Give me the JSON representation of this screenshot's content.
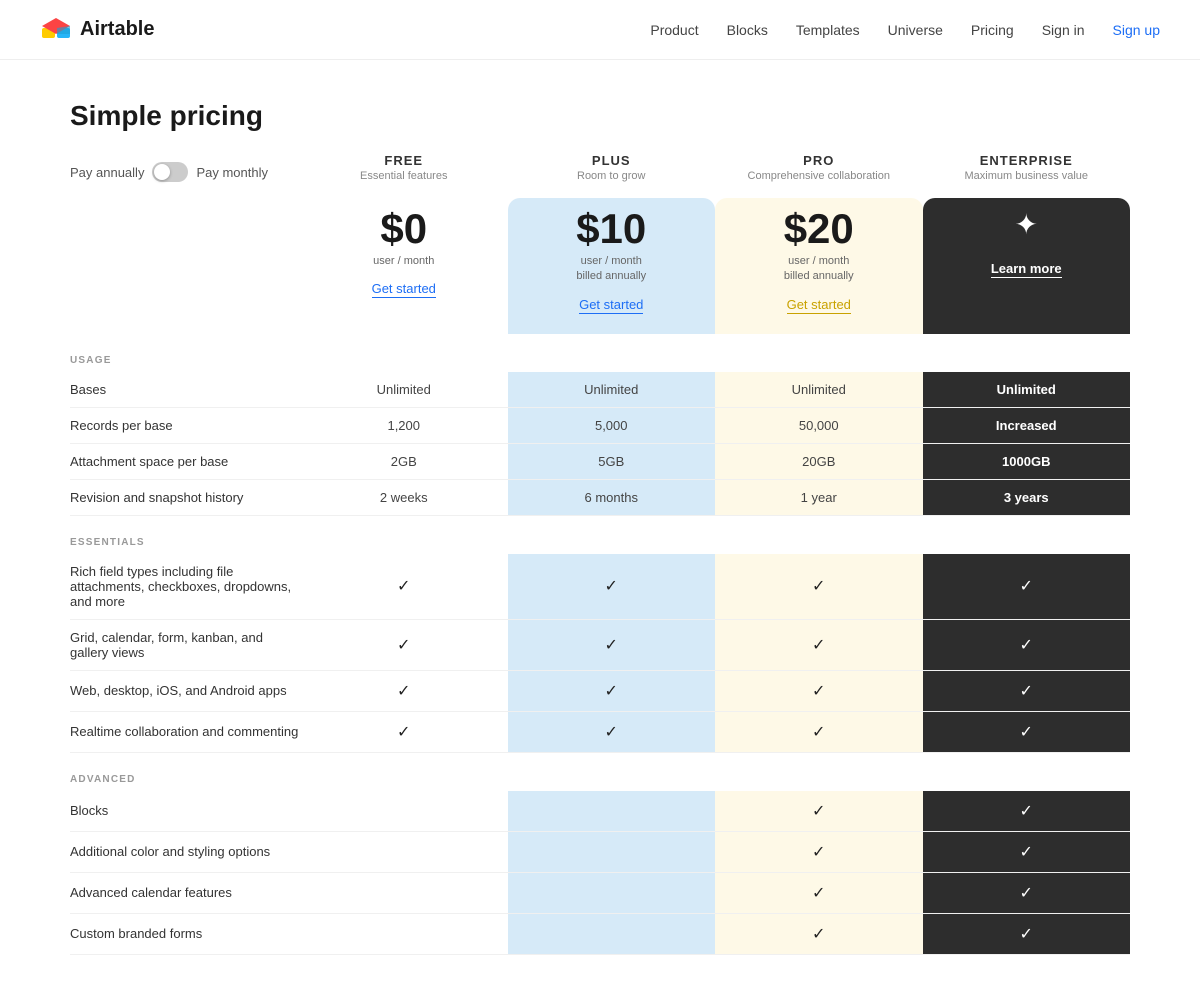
{
  "nav": {
    "logo_text": "Airtable",
    "links": [
      "Product",
      "Blocks",
      "Templates",
      "Universe",
      "Pricing"
    ],
    "signin": "Sign in",
    "signup": "Sign up"
  },
  "page": {
    "title": "Simple pricing",
    "billing_toggle": {
      "pay_annually": "Pay annually",
      "pay_monthly": "Pay monthly"
    }
  },
  "plans": [
    {
      "id": "free",
      "name": "FREE",
      "desc": "Essential features",
      "price": "$0",
      "price_sub": "user / month",
      "cta": "Get started",
      "cta_type": "free"
    },
    {
      "id": "plus",
      "name": "PLUS",
      "desc": "Room to grow",
      "price": "$10",
      "price_sub": "user / month\nbilled annually",
      "cta": "Get started",
      "cta_type": "plus"
    },
    {
      "id": "pro",
      "name": "PRO",
      "desc": "Comprehensive collaboration",
      "price": "$20",
      "price_sub": "user / month\nbilled annually",
      "cta": "Get started",
      "cta_type": "pro"
    },
    {
      "id": "enterprise",
      "name": "ENTERPRISE",
      "desc": "Maximum business value",
      "price": "",
      "price_sub": "",
      "cta": "Learn more",
      "cta_type": "enterprise"
    }
  ],
  "sections": [
    {
      "label": "USAGE",
      "rows": [
        {
          "feature": "Bases",
          "values": [
            "Unlimited",
            "Unlimited",
            "Unlimited",
            "Unlimited"
          ]
        },
        {
          "feature": "Records per base",
          "values": [
            "1,200",
            "5,000",
            "50,000",
            "Increased"
          ]
        },
        {
          "feature": "Attachment space per base",
          "values": [
            "2GB",
            "5GB",
            "20GB",
            "1000GB"
          ]
        },
        {
          "feature": "Revision and snapshot history",
          "values": [
            "2 weeks",
            "6 months",
            "1 year",
            "3 years"
          ]
        }
      ]
    },
    {
      "label": "ESSENTIALS",
      "rows": [
        {
          "feature": "Rich field types including file attachments, checkboxes, dropdowns, and more",
          "values": [
            "check",
            "check",
            "check",
            "check"
          ]
        },
        {
          "feature": "Grid, calendar, form, kanban, and gallery views",
          "values": [
            "check",
            "check",
            "check",
            "check"
          ]
        },
        {
          "feature": "Web, desktop, iOS, and Android apps",
          "values": [
            "check",
            "check",
            "check",
            "check"
          ]
        },
        {
          "feature": "Realtime collaboration and commenting",
          "values": [
            "check",
            "check",
            "check",
            "check"
          ]
        }
      ]
    },
    {
      "label": "ADVANCED",
      "rows": [
        {
          "feature": "Blocks",
          "values": [
            "",
            "",
            "check",
            "check"
          ]
        },
        {
          "feature": "Additional color and styling options",
          "values": [
            "",
            "",
            "check",
            "check"
          ]
        },
        {
          "feature": "Advanced calendar features",
          "values": [
            "",
            "",
            "check",
            "check"
          ]
        },
        {
          "feature": "Custom branded forms",
          "values": [
            "",
            "",
            "check",
            "check"
          ]
        }
      ]
    }
  ]
}
